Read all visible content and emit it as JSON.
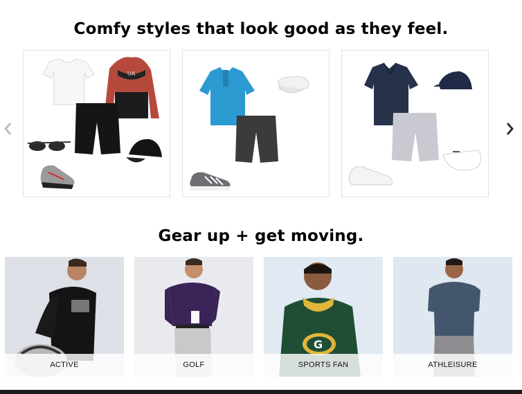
{
  "section_styles": {
    "title": "Comfy styles that look good as they feel."
  },
  "section_gear": {
    "title": "Gear up + get moving."
  },
  "carousel": {
    "prev_icon": "chevron-left-icon",
    "next_icon": "chevron-right-icon"
  },
  "categories": [
    {
      "label": "ACTIVE"
    },
    {
      "label": "GOLF"
    },
    {
      "label": "SPORTS FAN"
    },
    {
      "label": "ATHLEISURE"
    }
  ],
  "colors": {
    "heading": "#000000",
    "card_border": "#e2e2e2",
    "bottom_bar": "#1b1b1b"
  }
}
